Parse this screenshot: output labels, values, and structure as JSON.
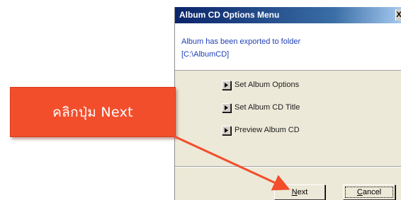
{
  "dialog": {
    "title": "Album CD Options Menu",
    "title_close": "X",
    "message_line1": "Album has been exported to folder",
    "message_line2": "[C:\\AlbumCD]",
    "menu_items": [
      {
        "label": "Set Album Options"
      },
      {
        "label": "Set Album CD Title"
      },
      {
        "label": "Preview Album CD"
      }
    ],
    "buttons": {
      "next_mnemonic": "N",
      "next_rest": "ext",
      "cancel_mnemonic": "C",
      "cancel_rest": "ancel"
    }
  },
  "callout": {
    "text": "คลิกปุ่ม Next",
    "color": "#f24e2c"
  },
  "icons": {
    "menu_bullet": "play-arrow-icon"
  }
}
